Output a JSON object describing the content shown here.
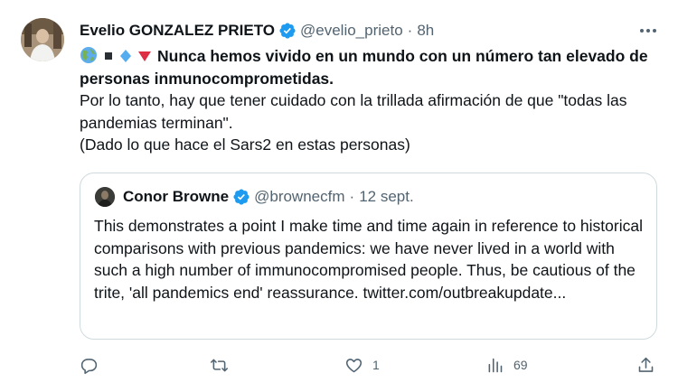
{
  "tweet": {
    "author_name": "Evelio GONZALEZ PRIETO",
    "handle": "@evelio_prieto",
    "separator": "·",
    "time": "8h",
    "text_bold": "Nunca hemos vivido en un mundo con un número tan elevado de personas inmunocomprometidas.",
    "text_line2": "Por lo tanto, hay que tener cuidado con la trillada afirmación de que \"todas las pandemias terminan\".",
    "text_line3": "(Dado lo que hace el Sars2 en estas personas)",
    "emoji_icons": [
      "globe-icon",
      "black-square-icon",
      "blue-diamond-icon",
      "red-triangle-icon"
    ]
  },
  "quote": {
    "author_name": "Conor Browne",
    "handle": "@brownecfm",
    "separator": "·",
    "time": "12 sept.",
    "text": "This demonstrates a point I make time and time again in reference to historical comparisons with previous pandemics: we have never lived in a world with such a high number of immunocompromised people. Thus, be cautious of the trite, 'all pandemics end' reassurance. twitter.com/outbreakupdate..."
  },
  "actions": {
    "reply_count": "",
    "retweet_count": "",
    "like_count": "1",
    "views_count": "69"
  },
  "colors": {
    "verified": "#1d9bf0",
    "secondary_text": "#536471",
    "border": "#cfd9de"
  }
}
